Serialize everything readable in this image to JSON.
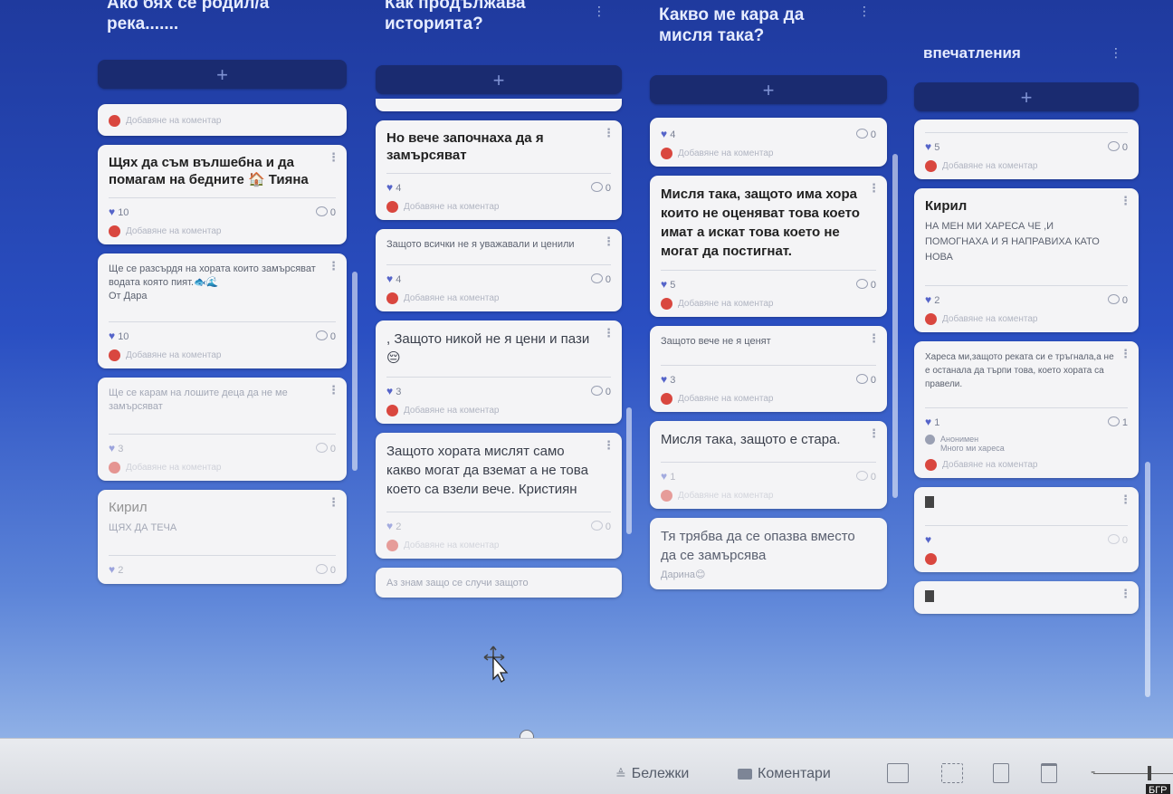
{
  "columns": [
    {
      "title": "Ако бях се родил/а\nрека.......",
      "add_label": "+",
      "cards": [
        {
          "kind": "comment-only",
          "comment_placeholder": "Добавяне на коментар"
        },
        {
          "kind": "post",
          "title": "Щях да съм вълшебна и да помагам на бедните 🏠 Тияна",
          "likes": "10",
          "comments": "0",
          "comment_placeholder": "Добавяне на коментар"
        },
        {
          "kind": "post",
          "text": "Ще се разсърдя на хората които замърсяват водата която пият.🐟🌊\nОт Дара",
          "likes": "10",
          "comments": "0",
          "comment_placeholder": "Добавяне на коментар"
        },
        {
          "kind": "post",
          "text": "Ще се карам на лошите деца да не ме замърсяват",
          "likes": "3",
          "comments": "0",
          "comment_placeholder": "Добавяне на коментар",
          "faded": true
        },
        {
          "kind": "post",
          "title": "Кирил",
          "text": "ЩЯХ ДА ТЕЧА",
          "likes": "2",
          "comments": "0",
          "faded": true
        }
      ]
    },
    {
      "title": "Как продължава\nисторията?",
      "add_label": "+",
      "cards": [
        {
          "kind": "stub"
        },
        {
          "kind": "post",
          "title": "Но вече започнаха да я замърсяват",
          "likes": "4",
          "comments": "0",
          "comment_placeholder": "Добавяне на коментар"
        },
        {
          "kind": "post",
          "text": "Защото всички не я уважавали и ценили",
          "likes": "4",
          "comments": "0",
          "comment_placeholder": "Добавяне на коментар"
        },
        {
          "kind": "post",
          "text_lg": ", Защото никой не я цени и пази 😔",
          "likes": "3",
          "comments": "0",
          "comment_placeholder": "Добавяне на коментар"
        },
        {
          "kind": "post",
          "text_lg": "Защото хората мислят само какво могат да вземат а не това което са взели вече. Кристиян",
          "likes": "2",
          "comments": "0",
          "comment_placeholder": "Добавяне на коментар"
        },
        {
          "kind": "post",
          "text": "Аз знам защо се случи защото",
          "faded": true
        }
      ]
    },
    {
      "title": "Какво ме кара да\nмисля така?",
      "add_label": "+",
      "cards": [
        {
          "kind": "post",
          "likes": "4",
          "comments": "0",
          "comment_placeholder": "Добавяне на коментар"
        },
        {
          "kind": "post",
          "title": "Мисля така, защото има хора които не оценяват това което имат а искат това което не могат да постигнат.",
          "likes": "5",
          "comments": "0",
          "comment_placeholder": "Добавяне на коментар"
        },
        {
          "kind": "post",
          "text": "Защото вече не я ценят",
          "likes": "3",
          "comments": "0",
          "comment_placeholder": "Добавяне на коментар"
        },
        {
          "kind": "post",
          "text_lg": "Мисля така, защото е стара.",
          "likes": "1",
          "comments": "0",
          "comment_placeholder": "Добавяне на коментар"
        },
        {
          "kind": "post",
          "text_lg": "Тя трябва да се опазва вместо да се замърсява",
          "text": "Дарина😊"
        }
      ]
    },
    {
      "title": "впечатления",
      "add_label": "+",
      "cards": [
        {
          "kind": "post",
          "likes": "5",
          "comments": "0",
          "comment_placeholder": "Добавяне на коментар"
        },
        {
          "kind": "post",
          "title": "Кирил",
          "text": "НА МЕН МИ ХАРЕСА ЧЕ ,И ПОМОГНАХА И Я НАПРАВИХА КАТО НОВА",
          "likes": "2",
          "comments": "0",
          "comment_placeholder": "Добавяне на коментар"
        },
        {
          "kind": "post",
          "text": "Хареса ми,защото реката си е тръгнала,а не е останала да търпи това, което хората са правели.",
          "likes": "1",
          "comments": "1",
          "reply_author": "Анонимен",
          "reply_text": "Много ми хареса",
          "comment_placeholder": "Добавяне на коментар"
        },
        {
          "kind": "post",
          "likes": "",
          "comments": "0"
        },
        {
          "kind": "post"
        }
      ]
    }
  ],
  "statusbar": {
    "notes_label": "Бележки",
    "comments_label": "Коментари",
    "lang_label": "БГР"
  }
}
